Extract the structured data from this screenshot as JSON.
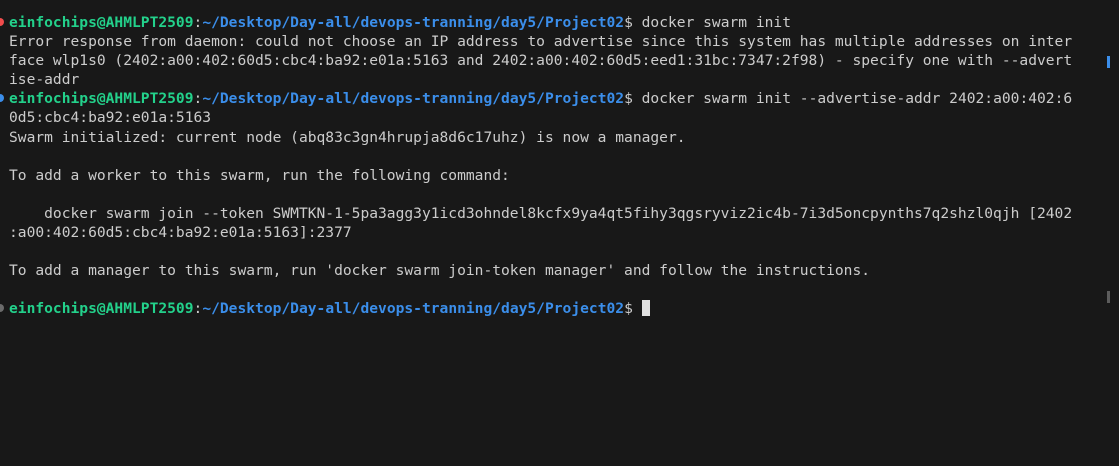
{
  "prompt": {
    "user_host": "einfochips@AHMLPT2509",
    "separator": ":",
    "path": "~/Desktop/Day-all/devops-tranning/day5/Project02",
    "symbol": "$ "
  },
  "commands": {
    "first": "docker swarm init",
    "second_part1": "docker swarm init --advertise-addr 2402:a00:402:6",
    "second_part2": "0d5:cbc4:ba92:e01a:5163"
  },
  "output": {
    "error1": "Error response from daemon: could not choose an IP address to advertise since this system has multiple addresses on inter",
    "error2": "face wlp1s0 (2402:a00:402:60d5:cbc4:ba92:e01a:5163 and 2402:a00:402:60d5:eed1:31bc:7347:2f98) - specify one with --advert",
    "error3": "ise-addr",
    "initialized": "Swarm initialized: current node (abq83c3gn4hrupja8d6c17uhz) is now a manager.",
    "worker_hint": "To add a worker to this swarm, run the following command:",
    "join1": "    docker swarm join --token SWMTKN-1-5pa3agg3y1icd3ohndel8kcfx9ya4qt5fihy3qgsryviz2ic4b-7i3d5oncpynths7q2shzl0qjh [2402",
    "join2": ":a00:402:60d5:cbc4:ba92:e01a:5163]:2377",
    "manager_hint": "To add a manager to this swarm, run 'docker swarm join-token manager' and follow the instructions."
  },
  "colors": {
    "background": "#181818",
    "user_host": "#23d18b",
    "path": "#3b8eea",
    "text": "#cccccc",
    "error_marker": "#f14c4c",
    "success_marker": "#3b8eea"
  },
  "icons": {
    "cursor": "block-cursor-icon"
  }
}
